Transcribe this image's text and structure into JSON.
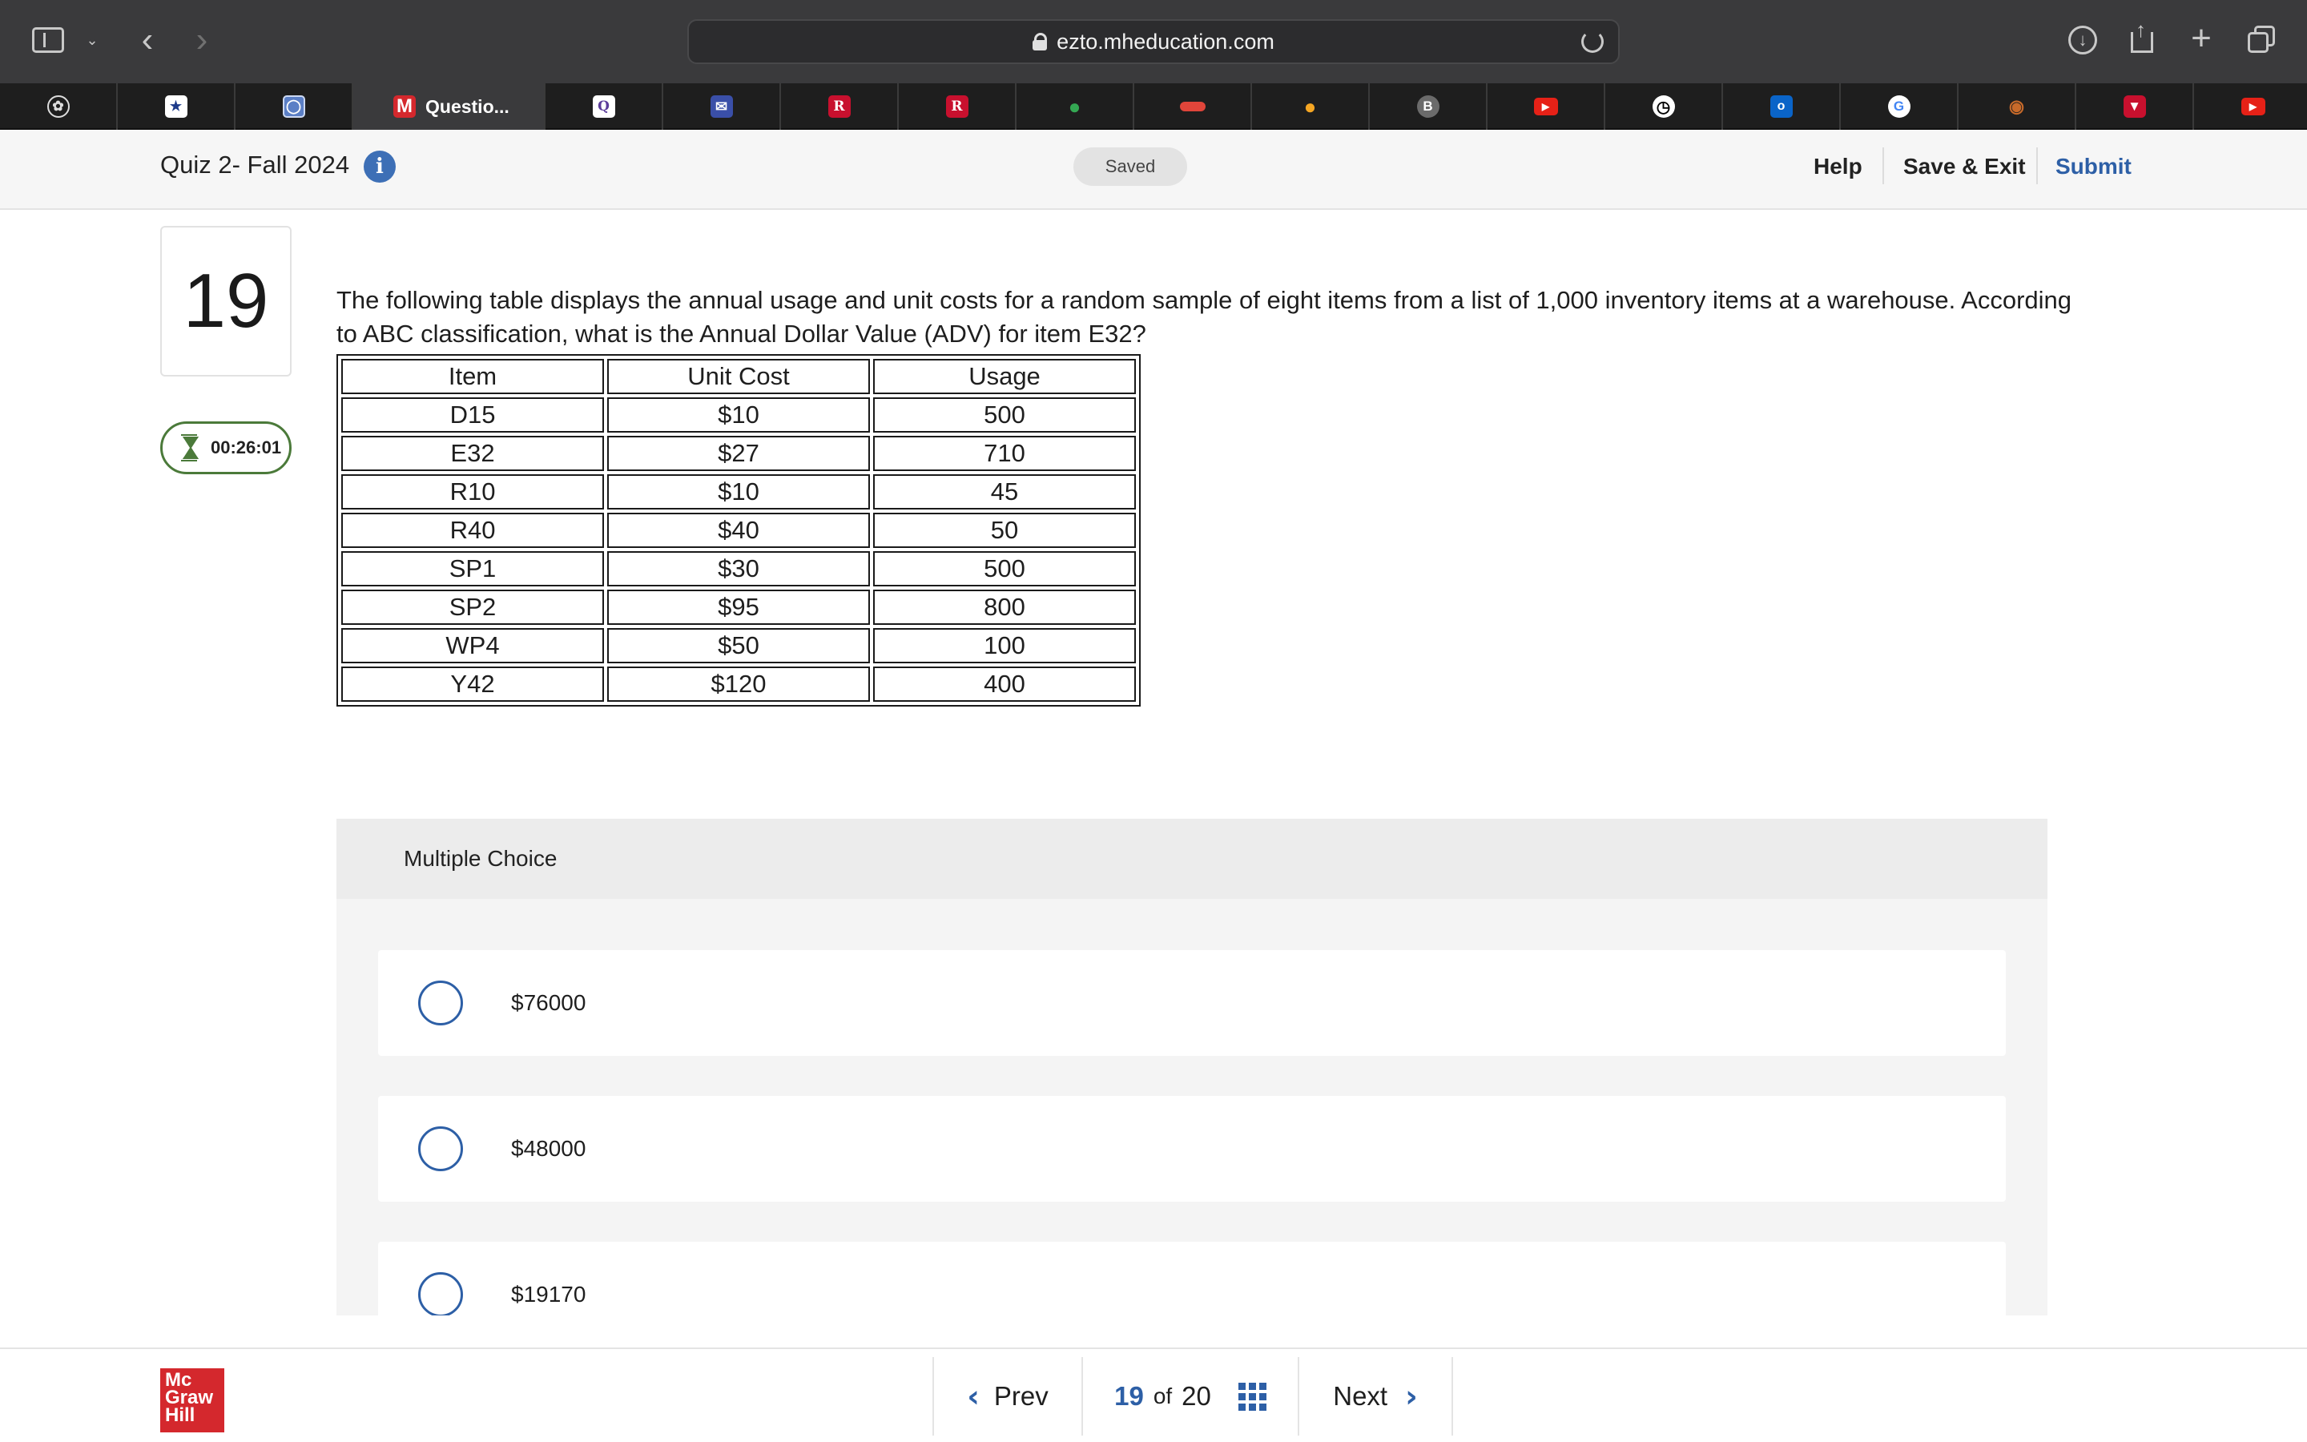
{
  "browser": {
    "url": "ezto.mheducation.com",
    "active_tab_label": "Questio...",
    "active_tab_icon_letter": "M",
    "tab_letters": {
      "b_tab": "B"
    }
  },
  "header": {
    "quiz_title": "Quiz 2- Fall 2024",
    "info_glyph": "i",
    "saved_label": "Saved",
    "help_label": "Help",
    "save_exit_label": "Save & Exit",
    "submit_label": "Submit"
  },
  "question": {
    "number": "19",
    "timer": "00:26:01",
    "prompt": "The following table displays the annual usage and unit costs for a random sample of eight items from a list of 1,000 inventory items at a warehouse. According to ABC classification, what is the Annual Dollar Value (ADV) for item E32?",
    "table": {
      "headers": [
        "Item",
        "Unit Cost",
        "Usage"
      ],
      "rows": [
        [
          "D15",
          "$10",
          "500"
        ],
        [
          "E32",
          "$27",
          "710"
        ],
        [
          "R10",
          "$10",
          "45"
        ],
        [
          "R40",
          "$40",
          "50"
        ],
        [
          "SP1",
          "$30",
          "500"
        ],
        [
          "SP2",
          "$95",
          "800"
        ],
        [
          "WP4",
          "$50",
          "100"
        ],
        [
          "Y42",
          "$120",
          "400"
        ]
      ]
    }
  },
  "multiple_choice": {
    "header": "Multiple Choice",
    "choices": [
      "$76000",
      "$48000",
      "$19170"
    ]
  },
  "footer": {
    "logo_lines": [
      "Mc",
      "Graw",
      "Hill"
    ],
    "prev_label": "Prev",
    "current_page": "19",
    "of_label": "of",
    "total_pages": "20",
    "next_label": "Next"
  }
}
